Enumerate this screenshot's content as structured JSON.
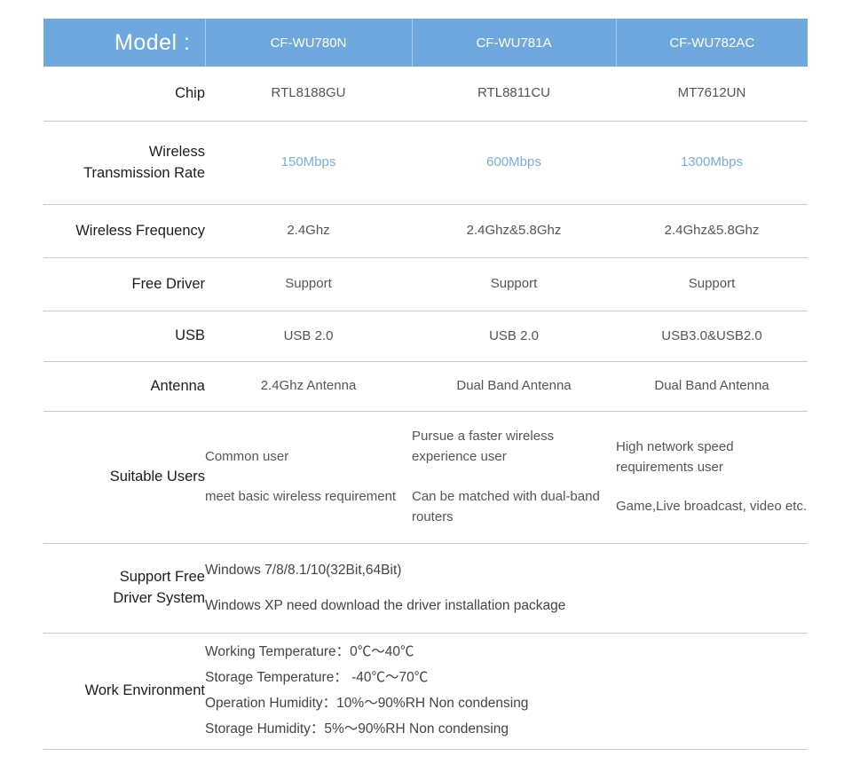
{
  "table": {
    "header": {
      "label": "Model :",
      "models": [
        "CF-WU780N",
        "CF-WU781A",
        "CF-WU782AC"
      ],
      "bg_color": "#6fa8de",
      "text_color": "#ffffff"
    },
    "accent_color": "#7aabe0",
    "divider_color": "#c9c9c9",
    "rows": [
      {
        "label": "Chip",
        "values": [
          "RTL8188GU",
          "RTL8811CU",
          "MT7612UN"
        ]
      },
      {
        "label": "Wireless\nTransmission Rate",
        "label_line1": "Wireless",
        "label_line2": "Transmission Rate",
        "values": [
          "150Mbps",
          "600Mbps",
          "1300Mbps"
        ],
        "highlight": true
      },
      {
        "label": "Wireless Frequency",
        "values": [
          "2.4Ghz",
          "2.4Ghz&5.8Ghz",
          "2.4Ghz&5.8Ghz"
        ]
      },
      {
        "label": "Free Driver",
        "values": [
          "Support",
          "Support",
          "Support"
        ]
      },
      {
        "label": "USB",
        "values": [
          "USB 2.0",
          "USB 2.0",
          "USB3.0&USB2.0"
        ]
      },
      {
        "label": "Antenna",
        "values": [
          "2.4Ghz Antenna",
          "Dual Band Antenna",
          "Dual Band Antenna"
        ]
      }
    ],
    "suitable_users": {
      "label": "Suitable Users",
      "columns": [
        [
          "Common user",
          "meet basic wireless requirement"
        ],
        [
          "Pursue a faster wireless experience user",
          "Can be matched with dual-band routers"
        ],
        [
          "High network speed requirements user",
          "Game,Live broadcast, video etc."
        ]
      ]
    },
    "support_free_driver_system": {
      "label_line1": "Support Free",
      "label_line2": "Driver System",
      "lines": [
        "Windows 7/8/8.1/10(32Bit,64Bit)",
        "Windows XP need download the driver installation package"
      ]
    },
    "work_environment": {
      "label": "Work Environment",
      "lines": [
        "Working Temperature：0℃～40℃",
        "Storage Temperature： -40℃～70℃",
        "Operation Humidity：10%～90%RH Non condensing",
        "Storage Humidity：5%～90%RH Non condensing"
      ]
    }
  }
}
